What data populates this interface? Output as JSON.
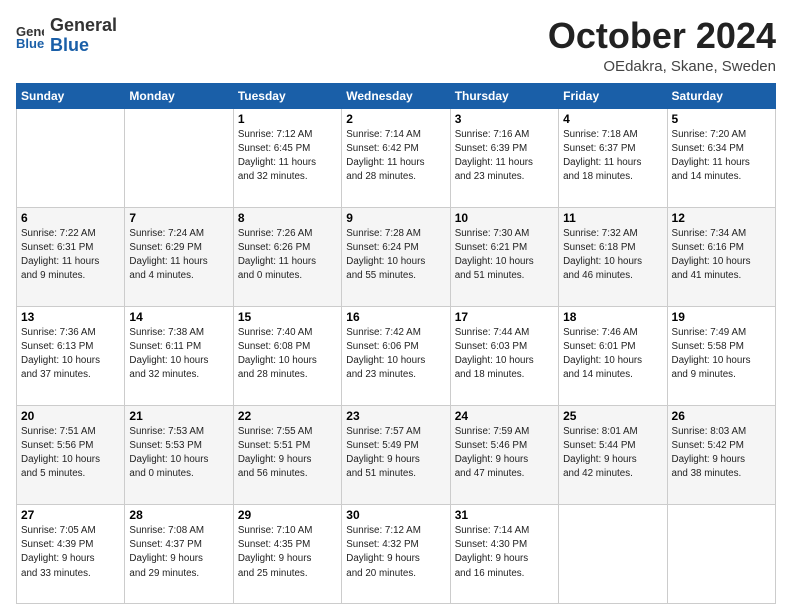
{
  "header": {
    "logo_general": "General",
    "logo_blue": "Blue",
    "month_title": "October 2024",
    "location": "OEdakra, Skane, Sweden"
  },
  "days_of_week": [
    "Sunday",
    "Monday",
    "Tuesday",
    "Wednesday",
    "Thursday",
    "Friday",
    "Saturday"
  ],
  "weeks": [
    [
      {
        "day": null,
        "info": null
      },
      {
        "day": null,
        "info": null
      },
      {
        "day": "1",
        "info": "Sunrise: 7:12 AM\nSunset: 6:45 PM\nDaylight: 11 hours\nand 32 minutes."
      },
      {
        "day": "2",
        "info": "Sunrise: 7:14 AM\nSunset: 6:42 PM\nDaylight: 11 hours\nand 28 minutes."
      },
      {
        "day": "3",
        "info": "Sunrise: 7:16 AM\nSunset: 6:39 PM\nDaylight: 11 hours\nand 23 minutes."
      },
      {
        "day": "4",
        "info": "Sunrise: 7:18 AM\nSunset: 6:37 PM\nDaylight: 11 hours\nand 18 minutes."
      },
      {
        "day": "5",
        "info": "Sunrise: 7:20 AM\nSunset: 6:34 PM\nDaylight: 11 hours\nand 14 minutes."
      }
    ],
    [
      {
        "day": "6",
        "info": "Sunrise: 7:22 AM\nSunset: 6:31 PM\nDaylight: 11 hours\nand 9 minutes."
      },
      {
        "day": "7",
        "info": "Sunrise: 7:24 AM\nSunset: 6:29 PM\nDaylight: 11 hours\nand 4 minutes."
      },
      {
        "day": "8",
        "info": "Sunrise: 7:26 AM\nSunset: 6:26 PM\nDaylight: 11 hours\nand 0 minutes."
      },
      {
        "day": "9",
        "info": "Sunrise: 7:28 AM\nSunset: 6:24 PM\nDaylight: 10 hours\nand 55 minutes."
      },
      {
        "day": "10",
        "info": "Sunrise: 7:30 AM\nSunset: 6:21 PM\nDaylight: 10 hours\nand 51 minutes."
      },
      {
        "day": "11",
        "info": "Sunrise: 7:32 AM\nSunset: 6:18 PM\nDaylight: 10 hours\nand 46 minutes."
      },
      {
        "day": "12",
        "info": "Sunrise: 7:34 AM\nSunset: 6:16 PM\nDaylight: 10 hours\nand 41 minutes."
      }
    ],
    [
      {
        "day": "13",
        "info": "Sunrise: 7:36 AM\nSunset: 6:13 PM\nDaylight: 10 hours\nand 37 minutes."
      },
      {
        "day": "14",
        "info": "Sunrise: 7:38 AM\nSunset: 6:11 PM\nDaylight: 10 hours\nand 32 minutes."
      },
      {
        "day": "15",
        "info": "Sunrise: 7:40 AM\nSunset: 6:08 PM\nDaylight: 10 hours\nand 28 minutes."
      },
      {
        "day": "16",
        "info": "Sunrise: 7:42 AM\nSunset: 6:06 PM\nDaylight: 10 hours\nand 23 minutes."
      },
      {
        "day": "17",
        "info": "Sunrise: 7:44 AM\nSunset: 6:03 PM\nDaylight: 10 hours\nand 18 minutes."
      },
      {
        "day": "18",
        "info": "Sunrise: 7:46 AM\nSunset: 6:01 PM\nDaylight: 10 hours\nand 14 minutes."
      },
      {
        "day": "19",
        "info": "Sunrise: 7:49 AM\nSunset: 5:58 PM\nDaylight: 10 hours\nand 9 minutes."
      }
    ],
    [
      {
        "day": "20",
        "info": "Sunrise: 7:51 AM\nSunset: 5:56 PM\nDaylight: 10 hours\nand 5 minutes."
      },
      {
        "day": "21",
        "info": "Sunrise: 7:53 AM\nSunset: 5:53 PM\nDaylight: 10 hours\nand 0 minutes."
      },
      {
        "day": "22",
        "info": "Sunrise: 7:55 AM\nSunset: 5:51 PM\nDaylight: 9 hours\nand 56 minutes."
      },
      {
        "day": "23",
        "info": "Sunrise: 7:57 AM\nSunset: 5:49 PM\nDaylight: 9 hours\nand 51 minutes."
      },
      {
        "day": "24",
        "info": "Sunrise: 7:59 AM\nSunset: 5:46 PM\nDaylight: 9 hours\nand 47 minutes."
      },
      {
        "day": "25",
        "info": "Sunrise: 8:01 AM\nSunset: 5:44 PM\nDaylight: 9 hours\nand 42 minutes."
      },
      {
        "day": "26",
        "info": "Sunrise: 8:03 AM\nSunset: 5:42 PM\nDaylight: 9 hours\nand 38 minutes."
      }
    ],
    [
      {
        "day": "27",
        "info": "Sunrise: 7:05 AM\nSunset: 4:39 PM\nDaylight: 9 hours\nand 33 minutes."
      },
      {
        "day": "28",
        "info": "Sunrise: 7:08 AM\nSunset: 4:37 PM\nDaylight: 9 hours\nand 29 minutes."
      },
      {
        "day": "29",
        "info": "Sunrise: 7:10 AM\nSunset: 4:35 PM\nDaylight: 9 hours\nand 25 minutes."
      },
      {
        "day": "30",
        "info": "Sunrise: 7:12 AM\nSunset: 4:32 PM\nDaylight: 9 hours\nand 20 minutes."
      },
      {
        "day": "31",
        "info": "Sunrise: 7:14 AM\nSunset: 4:30 PM\nDaylight: 9 hours\nand 16 minutes."
      },
      {
        "day": null,
        "info": null
      },
      {
        "day": null,
        "info": null
      }
    ]
  ]
}
